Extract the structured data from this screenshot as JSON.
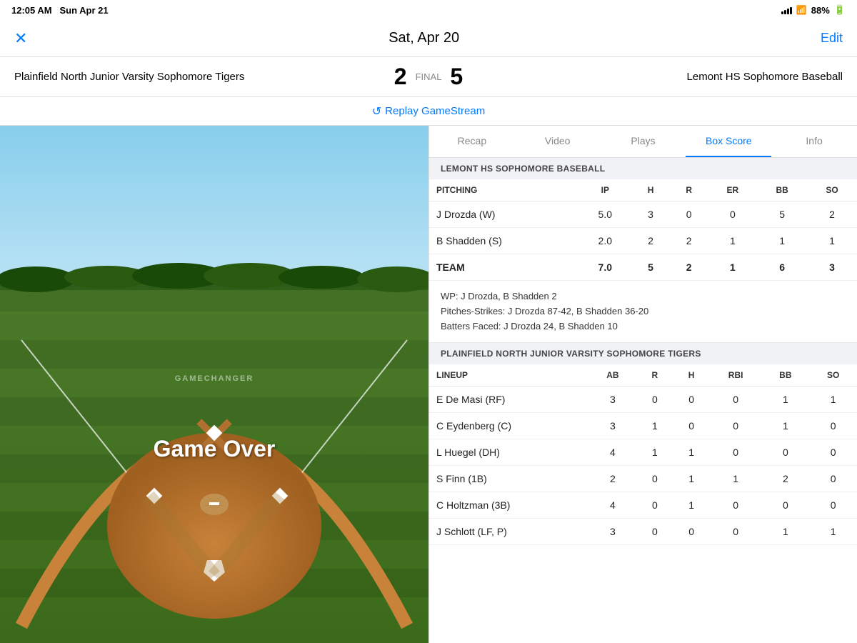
{
  "statusBar": {
    "time": "12:05 AM",
    "date": "Sun Apr 21",
    "battery": "88%"
  },
  "header": {
    "close": "✕",
    "title": "Sat, Apr 20",
    "edit": "Edit"
  },
  "game": {
    "teamLeft": "Plainfield North Junior Varsity Sophomore Tigers",
    "scoreLeft": "2",
    "final": "FINAL",
    "scoreRight": "5",
    "teamRight": "Lemont HS Sophomore Baseball",
    "replay": "Replay GameStream"
  },
  "tabs": [
    {
      "id": "recap",
      "label": "Recap"
    },
    {
      "id": "video",
      "label": "Video"
    },
    {
      "id": "plays",
      "label": "Plays"
    },
    {
      "id": "boxscore",
      "label": "Box Score",
      "active": true
    },
    {
      "id": "info",
      "label": "Info"
    }
  ],
  "lemont": {
    "sectionTitle": "LEMONT HS SOPHOMORE BASEBALL",
    "pitching": {
      "columns": [
        "PITCHING",
        "IP",
        "H",
        "R",
        "ER",
        "BB",
        "SO"
      ],
      "rows": [
        [
          "J Drozda (W)",
          "5.0",
          "3",
          "0",
          "0",
          "5",
          "2"
        ],
        [
          "B Shadden (S)",
          "2.0",
          "2",
          "2",
          "1",
          "1",
          "1"
        ],
        [
          "TEAM",
          "7.0",
          "5",
          "2",
          "1",
          "6",
          "3"
        ]
      ]
    },
    "notes": {
      "wp": "WP: J Drozda, B Shadden 2",
      "pitches": "Pitches-Strikes: J Drozda 87-42, B Shadden 36-20",
      "batters": "Batters Faced: J Drozda 24, B Shadden 10"
    }
  },
  "plainfield": {
    "sectionTitle": "PLAINFIELD NORTH JUNIOR VARSITY SOPHOMORE TIGERS",
    "lineup": {
      "columns": [
        "LINEUP",
        "AB",
        "R",
        "H",
        "RBI",
        "BB",
        "SO"
      ],
      "rows": [
        [
          "E De Masi (RF)",
          "3",
          "0",
          "0",
          "0",
          "1",
          "1"
        ],
        [
          "C Eydenberg (C)",
          "3",
          "1",
          "0",
          "0",
          "1",
          "0"
        ],
        [
          "L Huegel (DH)",
          "4",
          "1",
          "1",
          "0",
          "0",
          "0"
        ],
        [
          "S Finn (1B)",
          "2",
          "0",
          "1",
          "1",
          "2",
          "0"
        ],
        [
          "C Holtzman (3B)",
          "4",
          "0",
          "1",
          "0",
          "0",
          "0"
        ],
        [
          "J Schlott (LF, P)",
          "3",
          "0",
          "0",
          "0",
          "1",
          "1"
        ]
      ]
    }
  },
  "field": {
    "gameOver": "Game Over",
    "watermark": "GAMECHANGER"
  }
}
